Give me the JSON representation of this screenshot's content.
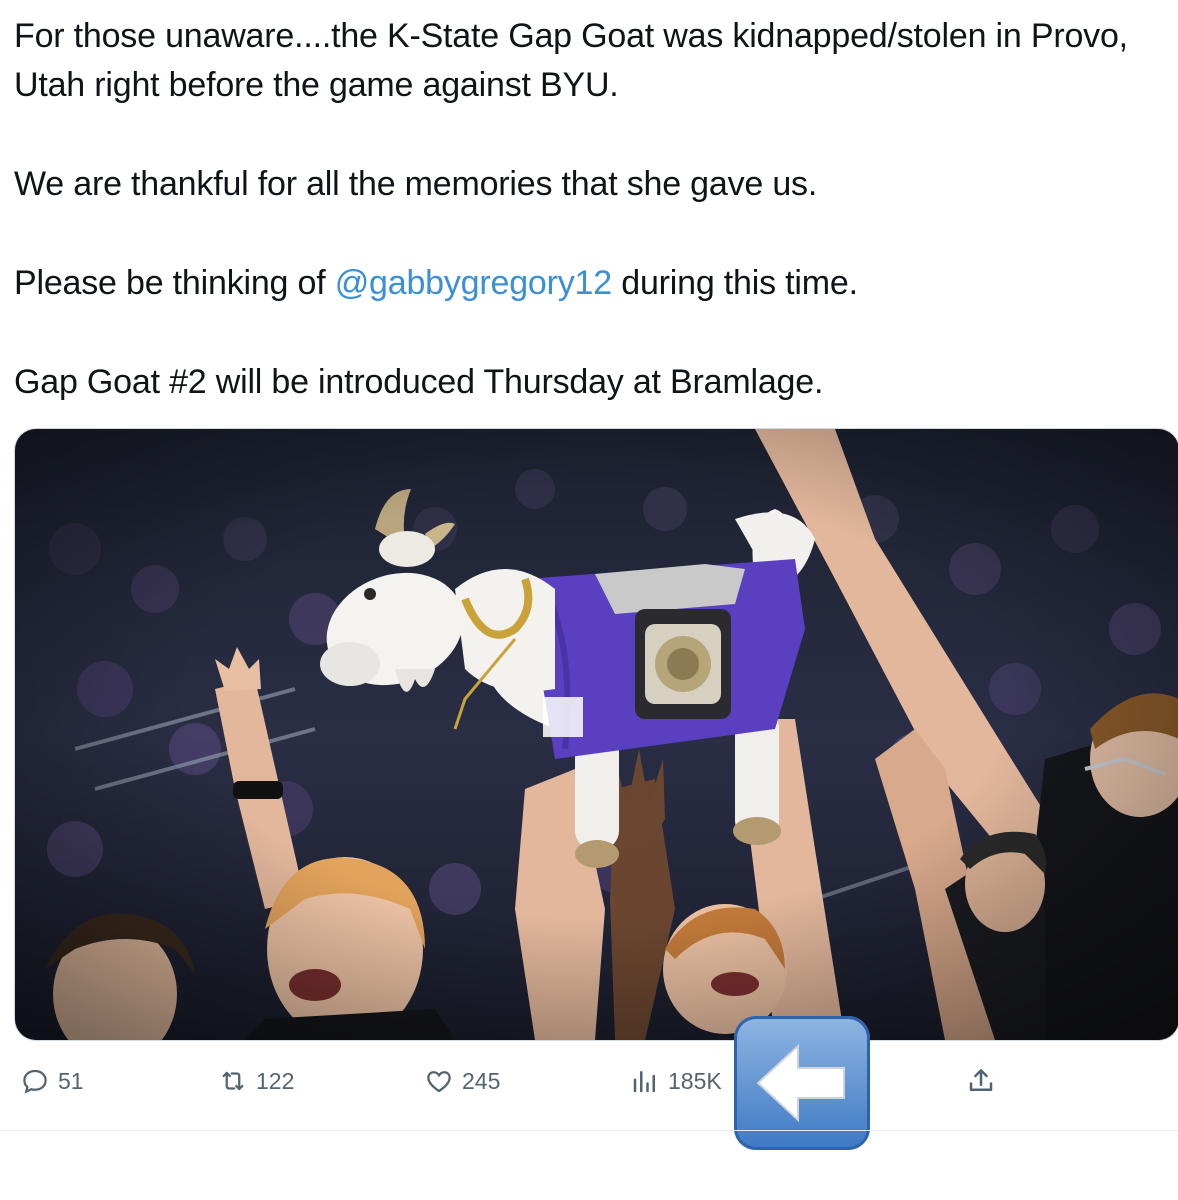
{
  "tweet": {
    "line1": "For those unaware....the K-State Gap Goat was kidnapped/stolen in Provo, Utah right before the game against BYU.",
    "line2": "We are thankful for all the memories that she gave us.",
    "line3_before": "Please be thinking of ",
    "line3_mention": "@gabbygregory12",
    "line3_after": " during this time.",
    "line4": "Gap Goat #2 will be introduced Thursday at Bramlage."
  },
  "actions": {
    "replies": "51",
    "retweets": "122",
    "likes": "245",
    "views": "185K"
  },
  "icons": {
    "reply": "reply-icon",
    "retweet": "retweet-icon",
    "like": "heart-icon",
    "views": "views-icon",
    "share": "share-icon",
    "emoji": "left-arrow-emoji-icon"
  },
  "colors": {
    "text": "#0f1419",
    "mention": "#3b8fd6",
    "meta": "#536471",
    "jersey": "#5a3fc0"
  }
}
